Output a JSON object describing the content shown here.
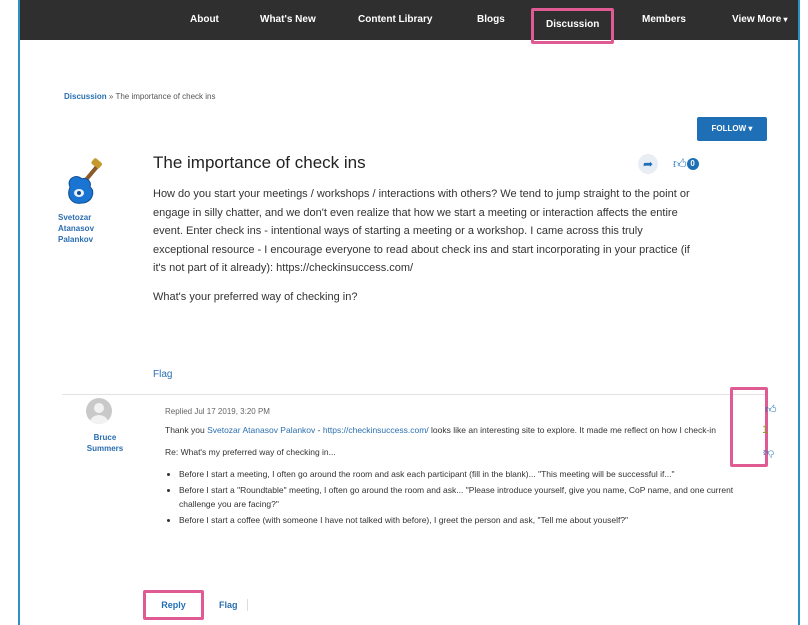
{
  "nav": {
    "items": [
      {
        "label": "About"
      },
      {
        "label": "What's New"
      },
      {
        "label": "Content Library"
      },
      {
        "label": "Blogs"
      },
      {
        "label": "Discussion"
      },
      {
        "label": "Members"
      },
      {
        "label": "View More"
      }
    ]
  },
  "breadcrumb": {
    "root": "Discussion",
    "separator": " » ",
    "current": "The importance of check ins"
  },
  "follow_label": "FOLLOW",
  "post": {
    "author": "Svetozar Atanasov Palankov",
    "title": "The importance of check ins",
    "like_count": "0",
    "paragraphs": [
      "How do you start your meetings / workshops / interactions with others? We tend to jump straight to the point or engage in silly chatter, and we don't even realize that how we start a meeting or interaction affects the entire event. Enter check ins - intentional ways of starting a meeting or a workshop. I came across this truly exceptional resource - I encourage everyone to read about check ins and start incorporating in your practice (if it's not part of it already): https://checkinsuccess.com/",
      "What's your preferred way of checking in?"
    ],
    "flag_label": "Flag"
  },
  "reply": {
    "author": "Bruce Summers",
    "meta": "Replied Jul 17 2019, 3:20 PM",
    "intro_prefix": "Thank you ",
    "mention": "Svetozar Atanasov Palankov",
    "intro_sep": " - ",
    "link": "https://checkinsuccess.com/",
    "intro_suffix": " looks like an interesting site to explore. It made me reflect on how I check-in",
    "re_line": "Re: What's my preferred way of checking in...",
    "bullets": [
      "Before I start a meeting, I often go around the room and ask each participant (fill in the blank)... \"This meeting will be successful if...\"",
      "Before I start a \"Roundtable\" meeting, I often go around the room and ask... \"Please introduce yourself, give you name, CoP name, and one current challenge you are facing?\"",
      "Before I start a coffee (with someone I have not talked with before), I greet the person and ask, \"Tell me about youself?\""
    ],
    "vote_count": "1",
    "reply_label": "Reply",
    "flag_label": "Flag"
  },
  "colors": {
    "accent": "#1f6fb7",
    "highlight": "#e05a94",
    "nav_bg": "#2f2f2f"
  },
  "icons": [
    "guitar-avatar-icon",
    "share-arrow-icon",
    "thumbs-up-icon",
    "thumbs-down-icon",
    "user-avatar-icon"
  ]
}
